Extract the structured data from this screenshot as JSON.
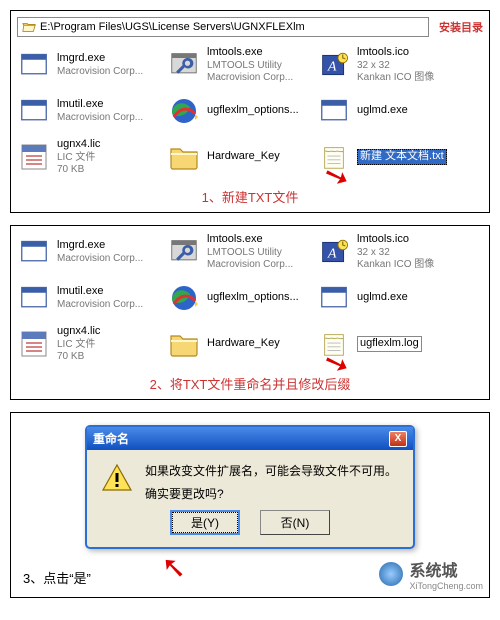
{
  "addr_bar": "E:\\Program Files\\UGS\\License Servers\\UGNXFLEXlm",
  "addr_label": "安装目录",
  "files": {
    "lmgrd": {
      "name": "lmgrd.exe",
      "sub": "Macrovision Corp..."
    },
    "lmtools_exe": {
      "name": "lmtools.exe",
      "sub1": "LMTOOLS Utility",
      "sub2": "Macrovision Corp..."
    },
    "lmtools_ico": {
      "name": "lmtools.ico",
      "sub1": "32 x 32",
      "sub2": "Kankan ICO 图像"
    },
    "lmutil": {
      "name": "lmutil.exe",
      "sub": "Macrovision Corp..."
    },
    "ugflexlm_opt": {
      "name": "ugflexlm_options..."
    },
    "uglmd": {
      "name": "uglmd.exe"
    },
    "ugnx4": {
      "name": "ugnx4.lic",
      "sub1": "LIC 文件",
      "sub2": "70 KB"
    },
    "hwkey": {
      "name": "Hardware_Key"
    },
    "newtxt": {
      "name": "新建 文本文档.txt"
    },
    "renamed": {
      "name": "ugflexlm.log"
    }
  },
  "caption1": "1、新建TXT文件",
  "caption2": "2、将TXT文件重命名并且修改后缀",
  "step3": "3、点击“是”",
  "dialog": {
    "title": "重命名",
    "msg1": "如果改变文件扩展名，可能会导致文件不可用。",
    "msg2": "确实要更改吗?",
    "yes": "是(Y)",
    "no": "否(N)",
    "close": "X"
  },
  "site": {
    "brand": "系统城",
    "url": "XiTongCheng.com"
  }
}
